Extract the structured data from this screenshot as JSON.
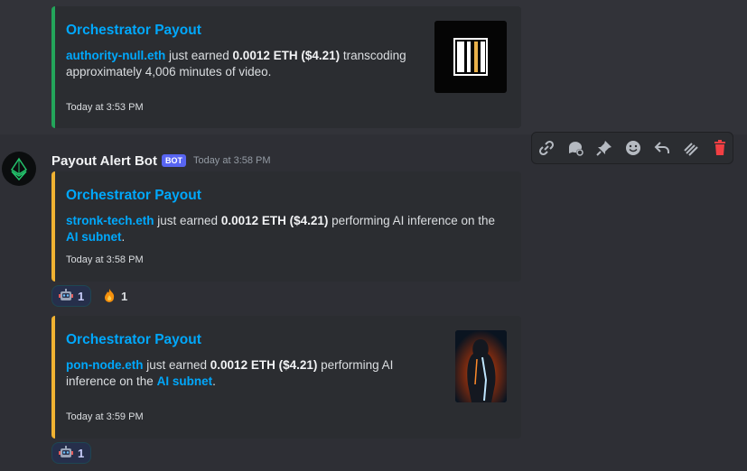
{
  "messages": [
    {
      "embed": {
        "title": "Orchestrator Payout",
        "node": "authority-null.eth",
        "earned_text": " just earned ",
        "amount": "0.0012 ETH ($4.21)",
        "activity": " transcoding",
        "detail": "approximately 4,006 minutes of video.",
        "time": "Today at 3:53 PM"
      }
    },
    {
      "author": {
        "name": "Payout Alert Bot",
        "tag": "BOT",
        "time": "Today at 3:58 PM"
      },
      "embed": {
        "title": "Orchestrator Payout",
        "node": "stronk-tech.eth",
        "earned_text": " just earned ",
        "amount": "0.0012 ETH ($4.21)",
        "activity": " performing AI inference on the",
        "link": "AI subnet",
        "period": ".",
        "time": "Today at 3:58 PM"
      },
      "reactions": [
        {
          "emoji": "robot",
          "count": "1"
        },
        {
          "emoji": "fire",
          "count": "1"
        }
      ]
    },
    {
      "embed": {
        "title": "Orchestrator Payout",
        "node": "pon-node.eth",
        "earned_text": " just earned ",
        "amount": "0.0012 ETH ($4.21)",
        "activity": " performing AI",
        "activity2": "inference on the ",
        "link": "AI subnet",
        "period": ".",
        "time": "Today at 3:59 PM"
      },
      "reactions": [
        {
          "emoji": "robot",
          "count": "1"
        }
      ]
    }
  ],
  "toolbar": [
    "link-icon",
    "thread-icon",
    "pin-icon",
    "emoji-icon",
    "reply-icon",
    "more-icon",
    "delete-icon"
  ],
  "colors": {
    "accent_link": "#00a8fc",
    "embed_green": "#23a55a",
    "embed_yellow": "#f0b232",
    "bot_tag": "#5865f2",
    "delete": "#f23f43"
  }
}
